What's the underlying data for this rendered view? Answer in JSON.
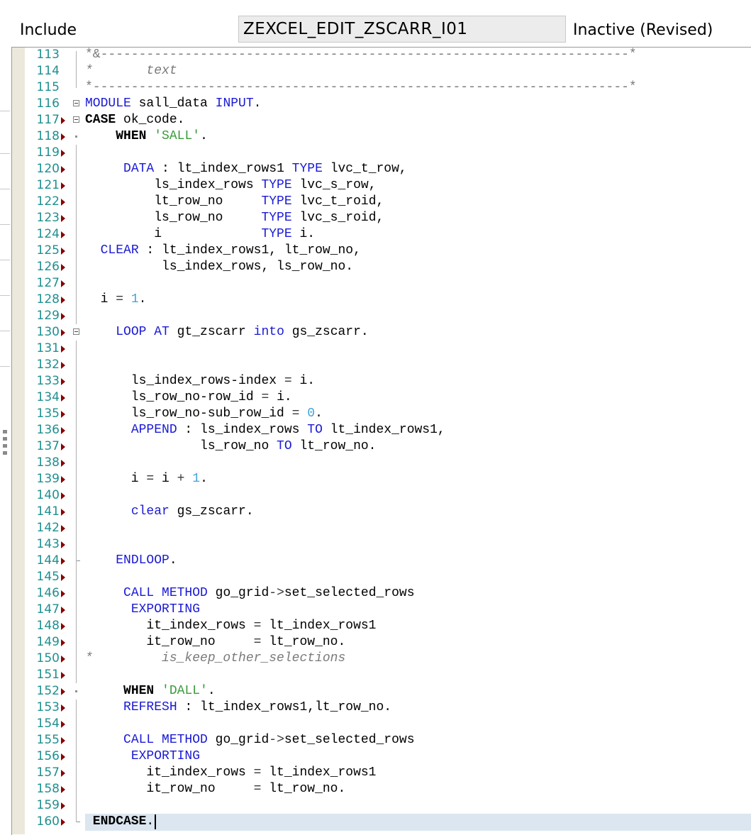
{
  "header": {
    "object_type_label": "Include",
    "object_name": "ZEXCEL_EDIT_ZSCARR_I01",
    "status": "Inactive (Revised)"
  },
  "editor": {
    "lines": [
      {
        "n": "113",
        "tokens": [
          [
            "sep",
            "*&---------------------------------------------------------------------*"
          ]
        ]
      },
      {
        "n": "114",
        "tokens": [
          [
            "cmt",
            "*       text"
          ]
        ]
      },
      {
        "n": "115",
        "tokens": [
          [
            "sep",
            "*----------------------------------------------------------------------*"
          ]
        ]
      },
      {
        "n": "116",
        "tokens": [
          [
            "kw",
            "MODULE"
          ],
          [
            "",
            " sall_data "
          ],
          [
            "kw",
            "INPUT"
          ],
          [
            "",
            "."
          ]
        ]
      },
      {
        "n": "117",
        "tokens": [
          [
            "kwb",
            "CASE"
          ],
          [
            "",
            " ok_code."
          ]
        ]
      },
      {
        "n": "118",
        "tokens": [
          [
            "",
            "    "
          ],
          [
            "kwb",
            "WHEN"
          ],
          [
            "",
            " "
          ],
          [
            "str",
            "'SALL'"
          ],
          [
            "",
            "."
          ]
        ]
      },
      {
        "n": "119",
        "tokens": []
      },
      {
        "n": "120",
        "tokens": [
          [
            "",
            "     "
          ],
          [
            "kw",
            "DATA"
          ],
          [
            "",
            " : lt_index_rows1 "
          ],
          [
            "kw",
            "TYPE"
          ],
          [
            "",
            " lvc_t_row,"
          ]
        ]
      },
      {
        "n": "121",
        "tokens": [
          [
            "",
            "         ls_index_rows "
          ],
          [
            "kw",
            "TYPE"
          ],
          [
            "",
            " lvc_s_row,"
          ]
        ]
      },
      {
        "n": "122",
        "tokens": [
          [
            "",
            "         lt_row_no     "
          ],
          [
            "kw",
            "TYPE"
          ],
          [
            "",
            " lvc_t_roid,"
          ]
        ]
      },
      {
        "n": "123",
        "tokens": [
          [
            "",
            "         ls_row_no     "
          ],
          [
            "kw",
            "TYPE"
          ],
          [
            "",
            " lvc_s_roid,"
          ]
        ]
      },
      {
        "n": "124",
        "tokens": [
          [
            "",
            "         i             "
          ],
          [
            "kw",
            "TYPE"
          ],
          [
            "",
            " i."
          ]
        ]
      },
      {
        "n": "125",
        "tokens": [
          [
            "",
            "  "
          ],
          [
            "kw",
            "CLEAR"
          ],
          [
            "",
            " : lt_index_rows1, lt_row_no,"
          ]
        ]
      },
      {
        "n": "126",
        "tokens": [
          [
            "",
            "          ls_index_rows, ls_row_no."
          ]
        ]
      },
      {
        "n": "127",
        "tokens": []
      },
      {
        "n": "128",
        "tokens": [
          [
            "",
            "  i "
          ],
          [
            "op",
            "="
          ],
          [
            "",
            " "
          ],
          [
            "num",
            "1"
          ],
          [
            "",
            "."
          ]
        ]
      },
      {
        "n": "129",
        "tokens": []
      },
      {
        "n": "130",
        "tokens": [
          [
            "",
            "    "
          ],
          [
            "kw",
            "LOOP AT"
          ],
          [
            "",
            " gt_zscarr "
          ],
          [
            "kw",
            "into"
          ],
          [
            "",
            " gs_zscarr."
          ]
        ]
      },
      {
        "n": "131",
        "tokens": []
      },
      {
        "n": "132",
        "tokens": []
      },
      {
        "n": "133",
        "tokens": [
          [
            "",
            "      ls_index_rows-index "
          ],
          [
            "op",
            "="
          ],
          [
            "",
            " i."
          ]
        ]
      },
      {
        "n": "134",
        "tokens": [
          [
            "",
            "      ls_row_no-row_id "
          ],
          [
            "op",
            "="
          ],
          [
            "",
            " i."
          ]
        ]
      },
      {
        "n": "135",
        "tokens": [
          [
            "",
            "      ls_row_no-sub_row_id "
          ],
          [
            "op",
            "="
          ],
          [
            "",
            " "
          ],
          [
            "num",
            "0"
          ],
          [
            "",
            "."
          ]
        ]
      },
      {
        "n": "136",
        "tokens": [
          [
            "",
            "      "
          ],
          [
            "kw",
            "APPEND"
          ],
          [
            "",
            " : ls_index_rows "
          ],
          [
            "kw",
            "TO"
          ],
          [
            "",
            " lt_index_rows1,"
          ]
        ]
      },
      {
        "n": "137",
        "tokens": [
          [
            "",
            "               ls_row_no "
          ],
          [
            "kw",
            "TO"
          ],
          [
            "",
            " lt_row_no."
          ]
        ]
      },
      {
        "n": "138",
        "tokens": []
      },
      {
        "n": "139",
        "tokens": [
          [
            "",
            "      i "
          ],
          [
            "op",
            "="
          ],
          [
            "",
            " i "
          ],
          [
            "op",
            "+"
          ],
          [
            "",
            " "
          ],
          [
            "num",
            "1"
          ],
          [
            "",
            "."
          ]
        ]
      },
      {
        "n": "140",
        "tokens": []
      },
      {
        "n": "141",
        "tokens": [
          [
            "",
            "      "
          ],
          [
            "kw",
            "clear"
          ],
          [
            "",
            " gs_zscarr."
          ]
        ]
      },
      {
        "n": "142",
        "tokens": []
      },
      {
        "n": "143",
        "tokens": []
      },
      {
        "n": "144",
        "tokens": [
          [
            "",
            "    "
          ],
          [
            "kw",
            "ENDLOOP"
          ],
          [
            "",
            "."
          ]
        ]
      },
      {
        "n": "145",
        "tokens": []
      },
      {
        "n": "146",
        "tokens": [
          [
            "",
            "     "
          ],
          [
            "kw",
            "CALL METHOD"
          ],
          [
            "",
            " go_grid"
          ],
          [
            "op",
            "->"
          ],
          [
            "",
            "set_selected_rows"
          ]
        ]
      },
      {
        "n": "147",
        "tokens": [
          [
            "",
            "      "
          ],
          [
            "kw",
            "EXPORTING"
          ]
        ]
      },
      {
        "n": "148",
        "tokens": [
          [
            "",
            "        it_index_rows "
          ],
          [
            "op",
            "="
          ],
          [
            "",
            " lt_index_rows1"
          ]
        ]
      },
      {
        "n": "149",
        "tokens": [
          [
            "",
            "        it_row_no     "
          ],
          [
            "op",
            "="
          ],
          [
            "",
            " lt_row_no."
          ]
        ]
      },
      {
        "n": "150",
        "tokens": [
          [
            "cmt",
            "*         is_keep_other_selections"
          ]
        ]
      },
      {
        "n": "151",
        "tokens": []
      },
      {
        "n": "152",
        "tokens": [
          [
            "",
            "     "
          ],
          [
            "kwb",
            "WHEN"
          ],
          [
            "",
            " "
          ],
          [
            "str",
            "'DALL'"
          ],
          [
            "",
            "."
          ]
        ]
      },
      {
        "n": "153",
        "tokens": [
          [
            "",
            "     "
          ],
          [
            "kw",
            "REFRESH"
          ],
          [
            "",
            " : lt_index_rows1,lt_row_no."
          ]
        ]
      },
      {
        "n": "154",
        "tokens": []
      },
      {
        "n": "155",
        "tokens": [
          [
            "",
            "     "
          ],
          [
            "kw",
            "CALL METHOD"
          ],
          [
            "",
            " go_grid"
          ],
          [
            "op",
            "->"
          ],
          [
            "",
            "set_selected_rows"
          ]
        ]
      },
      {
        "n": "156",
        "tokens": [
          [
            "",
            "      "
          ],
          [
            "kw",
            "EXPORTING"
          ]
        ]
      },
      {
        "n": "157",
        "tokens": [
          [
            "",
            "        it_index_rows "
          ],
          [
            "op",
            "="
          ],
          [
            "",
            " lt_index_rows1"
          ]
        ]
      },
      {
        "n": "158",
        "tokens": [
          [
            "",
            "        it_row_no     "
          ],
          [
            "op",
            "="
          ],
          [
            "",
            " lt_row_no."
          ]
        ]
      },
      {
        "n": "159",
        "tokens": []
      },
      {
        "n": "160",
        "tokens": [
          [
            "kwb",
            " ENDCASE"
          ],
          [
            "",
            "."
          ]
        ]
      }
    ]
  }
}
